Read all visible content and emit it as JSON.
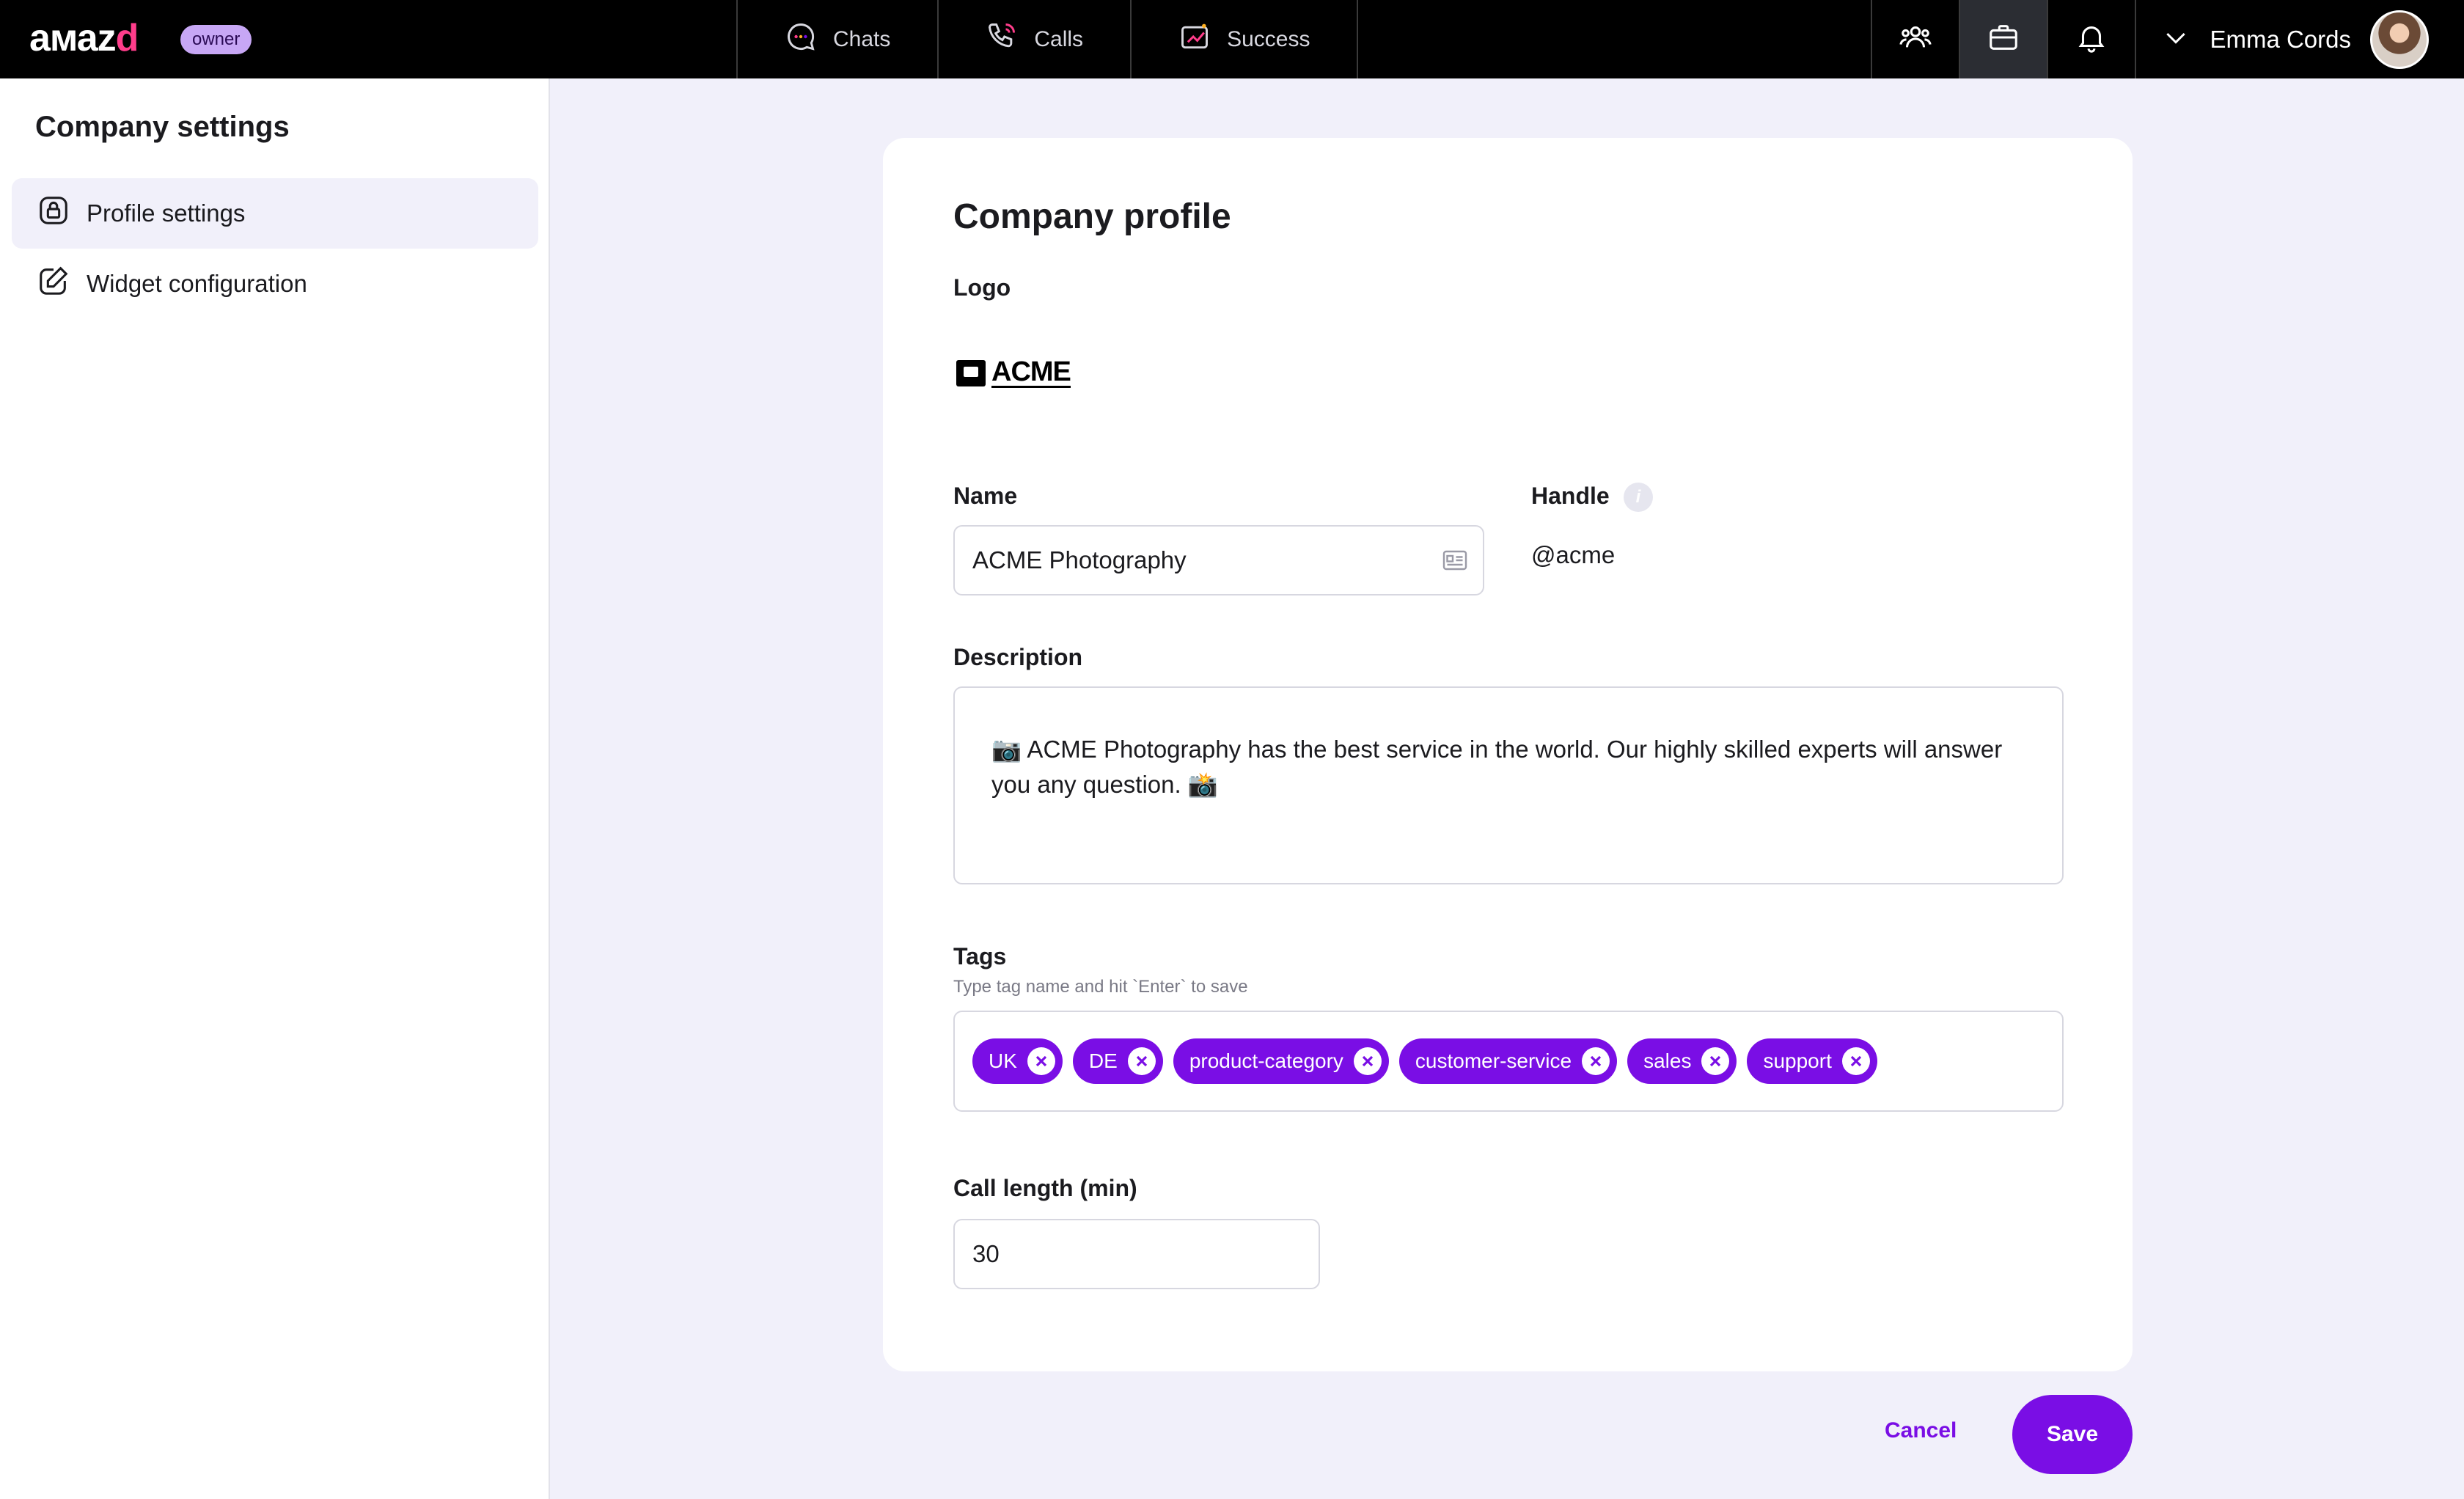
{
  "brand": {
    "logo_text_a": "aмаz",
    "logo_text_b": "d",
    "role_badge": "owner"
  },
  "nav": {
    "tabs": [
      {
        "label": "Chats",
        "icon": "chat-bubble-icon"
      },
      {
        "label": "Calls",
        "icon": "phone-icon"
      },
      {
        "label": "Success",
        "icon": "success-chart-icon"
      }
    ]
  },
  "toolbar": {
    "icons": [
      "users-icon",
      "briefcase-icon",
      "bell-icon"
    ],
    "active_icon": "briefcase-icon"
  },
  "user": {
    "name": "Emma Cords"
  },
  "sidebar": {
    "title": "Company settings",
    "items": [
      {
        "label": "Profile settings",
        "icon": "lock-icon",
        "active": true
      },
      {
        "label": "Widget configuration",
        "icon": "edit-icon",
        "active": false
      }
    ]
  },
  "profile": {
    "title": "Company profile",
    "logo_label": "Logo",
    "logo_text": "ACME",
    "name_label": "Name",
    "name_value": "ACME Photography",
    "handle_label": "Handle",
    "handle_value": "@acme",
    "description_label": "Description",
    "description_value": "📷  ACME Photography has the best service in the world. Our highly skilled experts will answer you any question.  📸",
    "tags_label": "Tags",
    "tags_hint": "Type tag name and hit `Enter` to save",
    "tags": [
      "UK",
      "DE",
      "product-category",
      "customer-service",
      "sales",
      "support"
    ],
    "call_length_label": "Call length (min)",
    "call_length_value": "30"
  },
  "actions": {
    "cancel_label": "Cancel",
    "save_label": "Save"
  },
  "colors": {
    "accent": "#7a0ee5",
    "background": "#f1f0fa",
    "topbar": "#000000"
  }
}
